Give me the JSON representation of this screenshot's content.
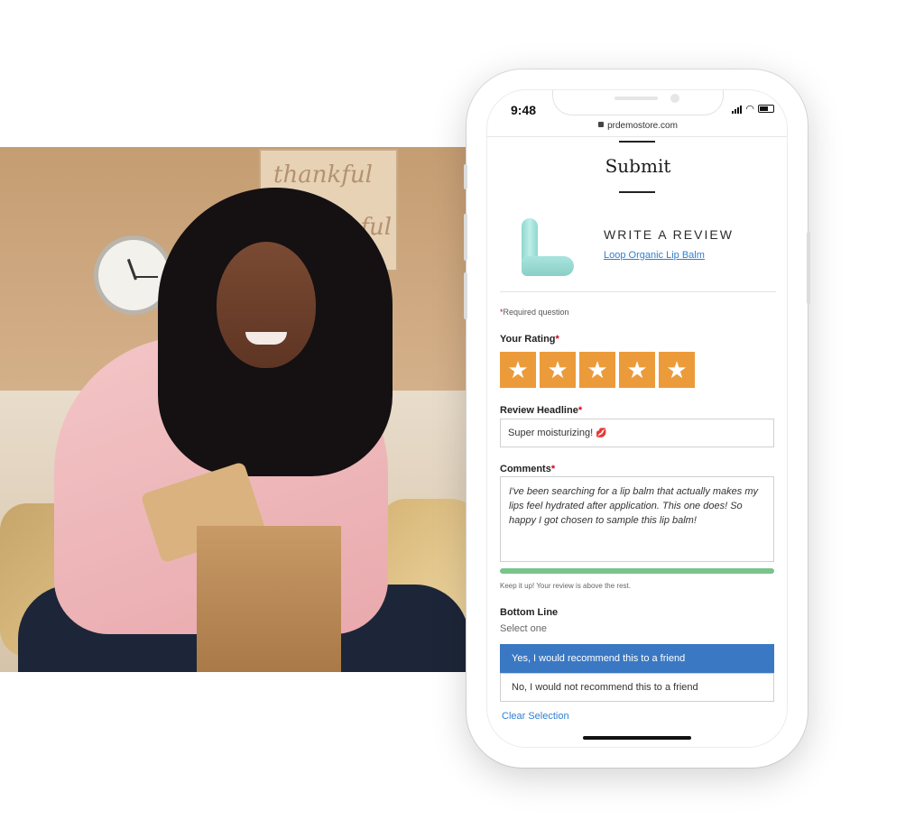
{
  "status_bar": {
    "time": "9:48",
    "url": "prdemostore.com"
  },
  "form": {
    "title": "Submit",
    "heading": "WRITE A REVIEW",
    "product_name": "Loop Organic Lip Balm",
    "required_note": "Required question",
    "rating": {
      "label": "Your Rating",
      "value": 5,
      "max": 5
    },
    "headline": {
      "label": "Review Headline",
      "value": "Super moisturizing!"
    },
    "comments": {
      "label": "Comments",
      "value": "I've been searching for a lip balm that actually makes my lips feel hydrated after application. This one does! So happy I got chosen to sample this lip balm!",
      "progress": 1.0,
      "hint": "Keep it up! Your review is above the rest."
    },
    "bottom_line": {
      "label": "Bottom Line",
      "sub": "Select one",
      "options": [
        "Yes, I would recommend this to a friend",
        "No, I would not recommend this to a friend"
      ],
      "selected_index": 0,
      "clear": "Clear Selection"
    }
  },
  "photo": {
    "sign_text": [
      "thankful",
      "grateful"
    ]
  },
  "colors": {
    "star": "#ec9b3b",
    "selected": "#3a78c3",
    "link": "#2f7fd1",
    "progress": "#79c48a",
    "required": "#d0021b"
  }
}
